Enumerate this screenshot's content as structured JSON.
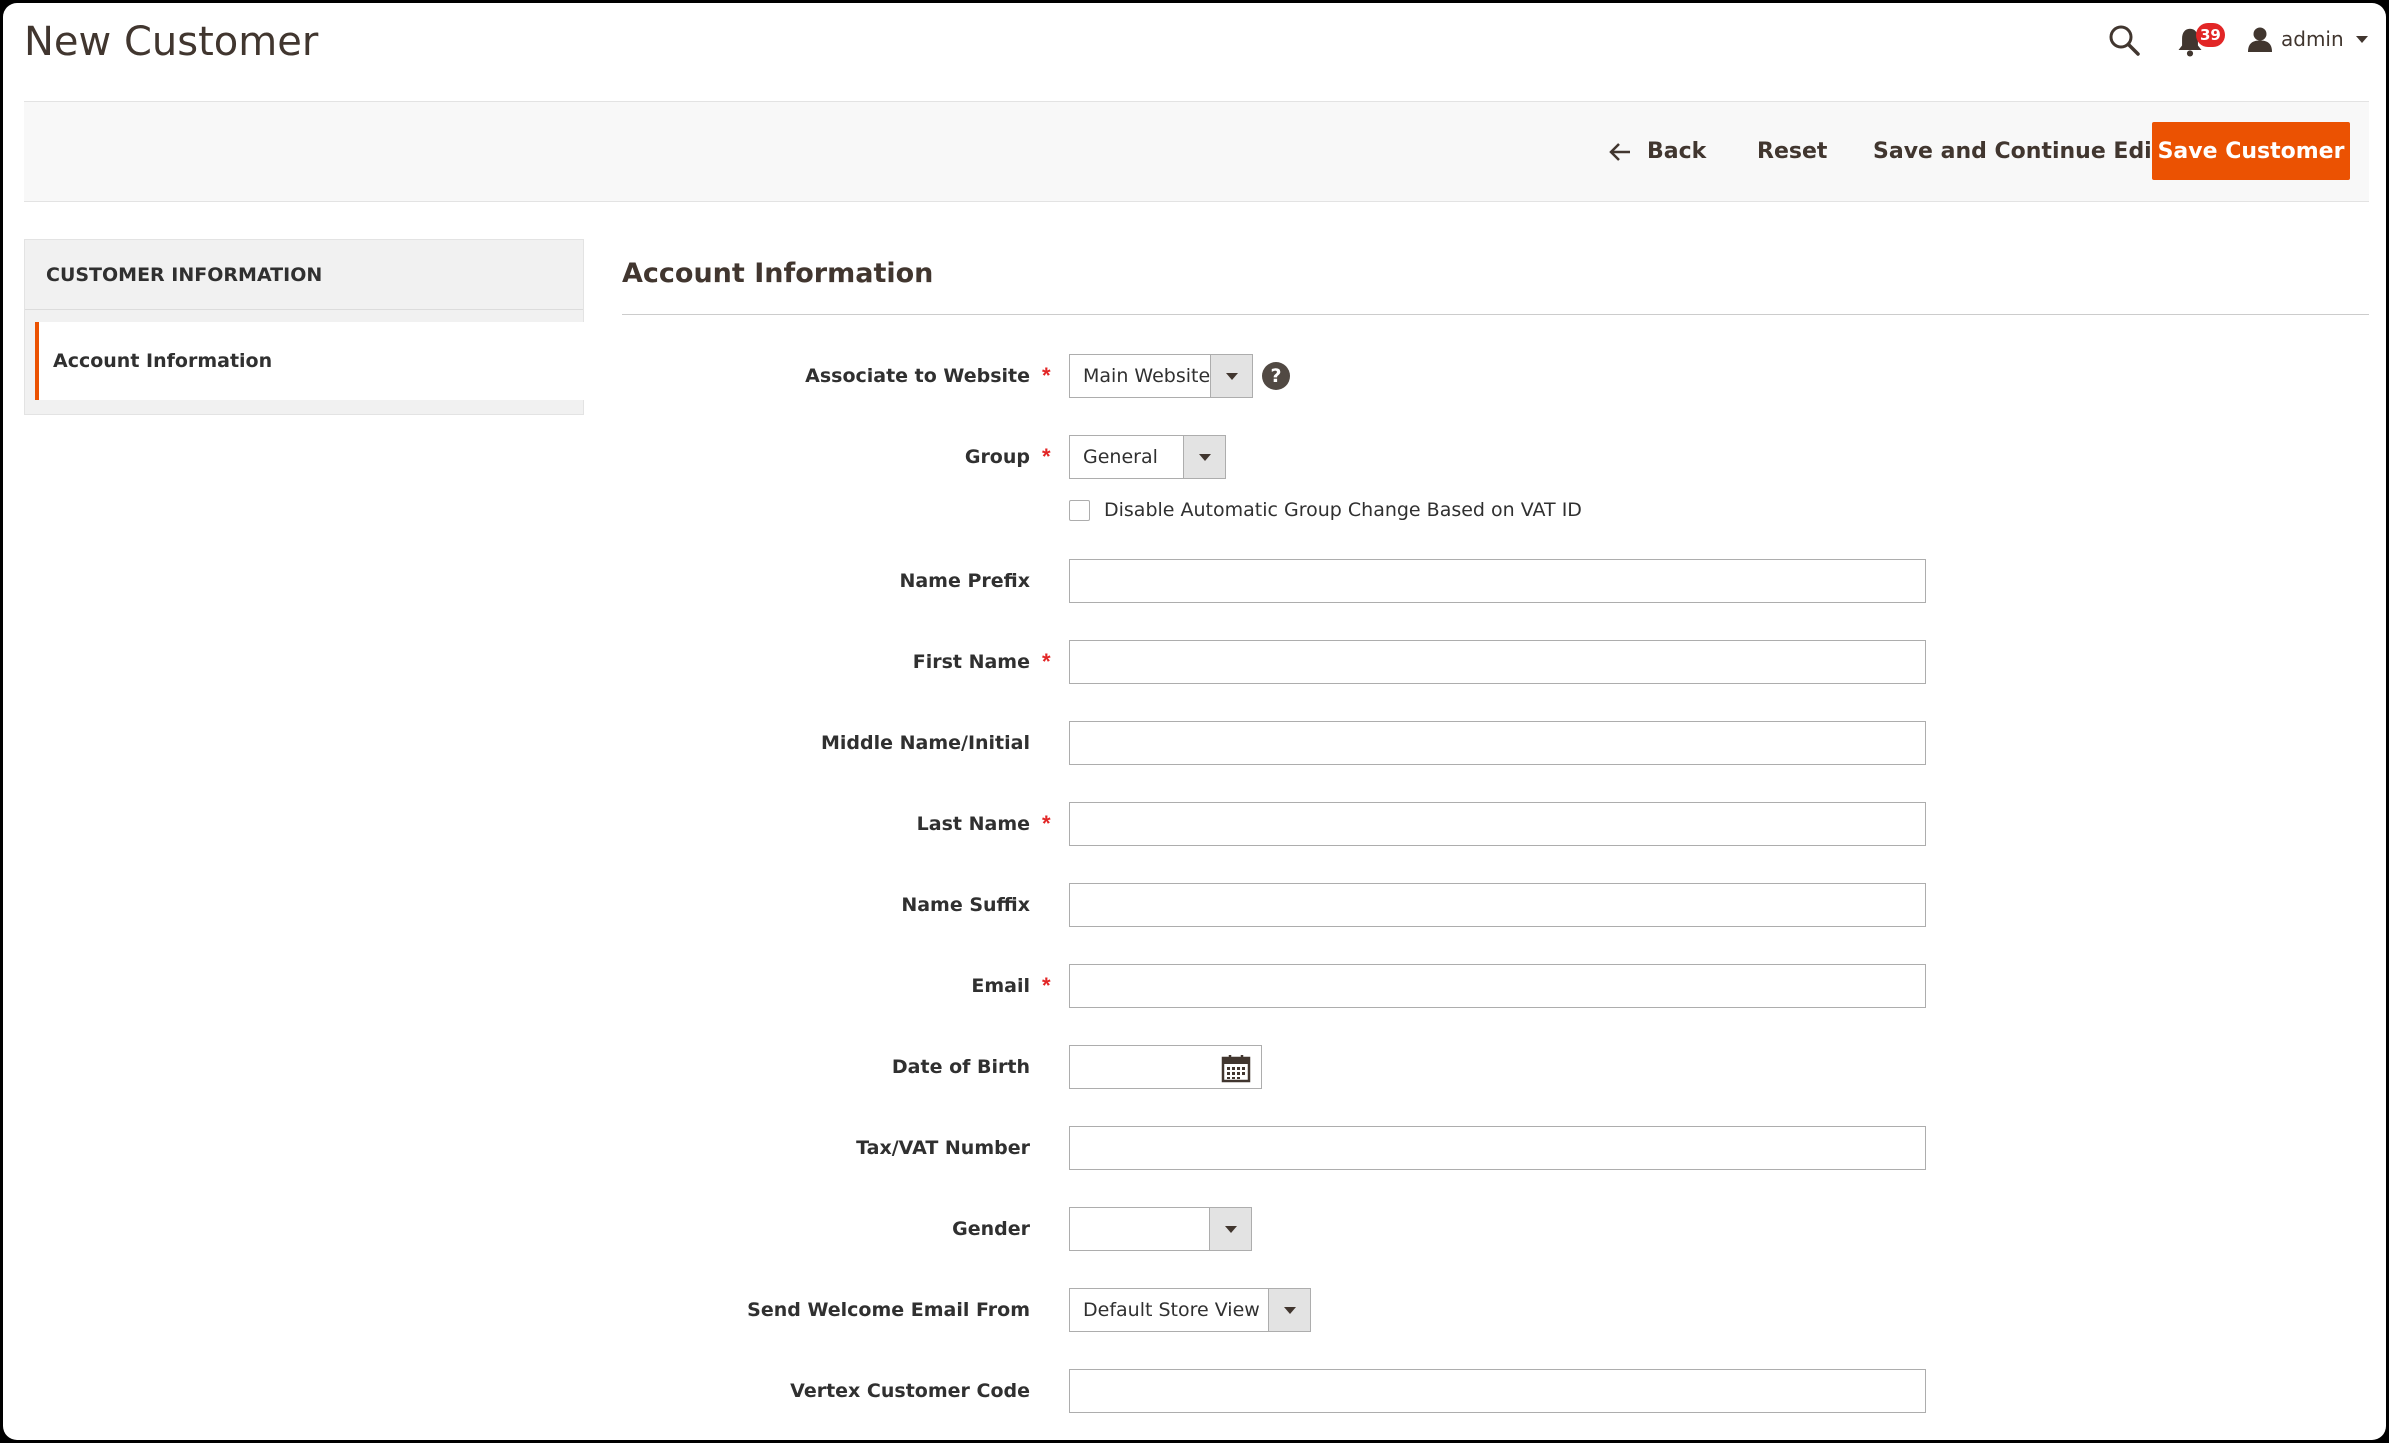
{
  "header": {
    "title": "New Customer",
    "notifications_count": "39",
    "user_name": "admin"
  },
  "actions": {
    "back": "Back",
    "reset": "Reset",
    "save_continue": "Save and Continue Edit",
    "save": "Save Customer"
  },
  "sidebar": {
    "heading": "CUSTOMER INFORMATION",
    "items": [
      {
        "label": "Account Information",
        "active": true
      }
    ]
  },
  "form": {
    "section_title": "Account Information",
    "fields": {
      "website": {
        "label": "Associate to Website",
        "value": "Main Website",
        "required": true
      },
      "group": {
        "label": "Group",
        "value": "General",
        "required": true
      },
      "disable_group_change": {
        "label": "Disable Automatic Group Change Based on VAT ID",
        "checked": false
      },
      "prefix": {
        "label": "Name Prefix",
        "value": ""
      },
      "first_name": {
        "label": "First Name",
        "value": "",
        "required": true
      },
      "middle_name": {
        "label": "Middle Name/Initial",
        "value": ""
      },
      "last_name": {
        "label": "Last Name",
        "value": "",
        "required": true
      },
      "suffix": {
        "label": "Name Suffix",
        "value": ""
      },
      "email": {
        "label": "Email",
        "value": "",
        "required": true
      },
      "dob": {
        "label": "Date of Birth",
        "value": ""
      },
      "taxvat": {
        "label": "Tax/VAT Number",
        "value": ""
      },
      "gender": {
        "label": "Gender",
        "value": ""
      },
      "welcome_from": {
        "label": "Send Welcome Email From",
        "value": "Default Store View"
      },
      "vertex_code": {
        "label": "Vertex Customer Code",
        "value": ""
      }
    },
    "required_mark": "*",
    "help_mark": "?"
  },
  "colors": {
    "accent": "#eb5202",
    "required": "#e22626",
    "badge": "#e22626"
  }
}
